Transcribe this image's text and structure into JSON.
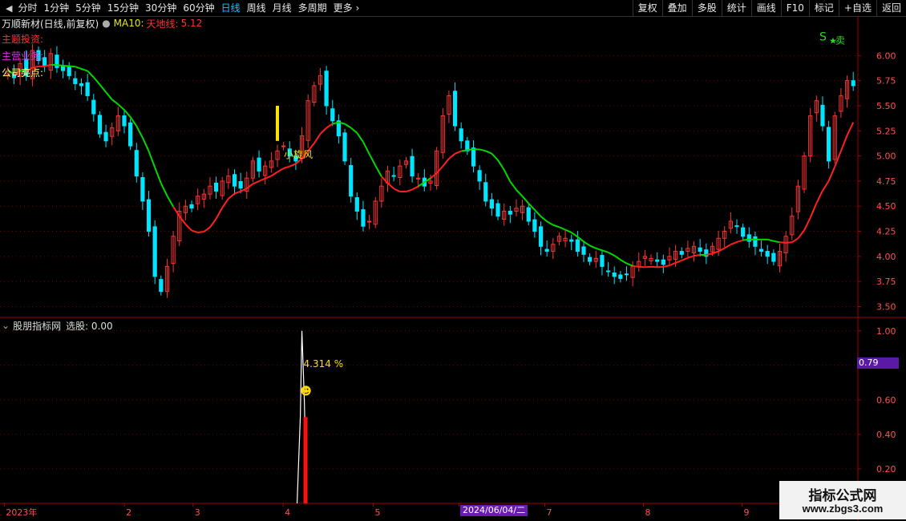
{
  "toolbar": {
    "periods": [
      "分时",
      "1分钟",
      "5分钟",
      "15分钟",
      "30分钟",
      "60分钟",
      "日线",
      "周线",
      "月线",
      "多周期",
      "更多"
    ],
    "active_period": "日线",
    "actions": [
      "复权",
      "叠加",
      "多股",
      "统计",
      "画线",
      "F10",
      "标记",
      "+自选",
      "返回"
    ]
  },
  "main_panel": {
    "stock_title": "万顺新材(日线,前复权)",
    "ma_label": "MA10:",
    "tiandi_label": "天地线:",
    "tiandi_value": "5.12",
    "info_lines": [
      "主题投资:",
      "主营业务:",
      "公司亮点:"
    ],
    "annotation_sell": "S",
    "annotation_sell_text": "卖",
    "annotation_xuanfeng": "小旋风",
    "y_ticks": [
      "6.00",
      "5.75",
      "5.50",
      "5.25",
      "5.00",
      "4.75",
      "4.50",
      "4.25",
      "4.00",
      "3.75",
      "3.50"
    ]
  },
  "sub_panel": {
    "title": "股朋指标网",
    "select_label": "选股: 0.00",
    "percent_label": "4.314 %",
    "y_ticks": [
      "1.00",
      "0.80",
      "0.60",
      "0.40",
      "0.20"
    ],
    "current_value": "0.79"
  },
  "x_axis": {
    "labels": [
      "2023年",
      "2",
      "3",
      "4",
      "5",
      "6",
      "7",
      "8",
      "9"
    ],
    "cursor_date": "2024/06/04/二"
  },
  "watermark": {
    "site_name": "指标公式网",
    "url": "www.zbgs3.com"
  },
  "colors": {
    "up": "#ff3232",
    "down": "#00e5ff",
    "ma_green": "#00d800",
    "ma_red": "#ff2020",
    "grid": "#7a0000"
  },
  "chart_data": {
    "type": "candlestick",
    "y_range": [
      3.4,
      6.25
    ],
    "sub_y_range": [
      0,
      1.05
    ],
    "closes": [
      5.85,
      5.78,
      5.92,
      5.8,
      6.05,
      5.95,
      5.9,
      6.02,
      5.88,
      5.85,
      5.8,
      5.72,
      5.7,
      5.6,
      5.42,
      5.22,
      5.15,
      5.28,
      5.4,
      5.3,
      5.1,
      4.8,
      4.55,
      4.25,
      3.8,
      3.65,
      3.9,
      4.2,
      4.45,
      4.5,
      4.48,
      4.6,
      4.62,
      4.7,
      4.65,
      4.75,
      4.8,
      4.7,
      4.68,
      4.78,
      4.95,
      4.85,
      4.9,
      4.95,
      5.05,
      5.1,
      5.0,
      4.95,
      5.2,
      5.55,
      5.7,
      5.8,
      5.5,
      5.35,
      5.2,
      4.95,
      4.6,
      4.45,
      4.3,
      4.35,
      4.55,
      4.7,
      4.85,
      4.8,
      4.9,
      4.95,
      4.8,
      4.78,
      4.7,
      4.75,
      5.05,
      5.4,
      5.6,
      5.3,
      5.15,
      5.05,
      4.9,
      4.75,
      4.55,
      4.48,
      4.4,
      4.45,
      4.42,
      4.48,
      4.5,
      4.35,
      4.25,
      4.1,
      4.05,
      4.12,
      4.2,
      4.18,
      4.15,
      4.05,
      4.02,
      3.95,
      3.98,
      3.9,
      3.85,
      3.8,
      3.78,
      3.82,
      3.9,
      3.95,
      4.0,
      3.98,
      3.95,
      3.92,
      4.0,
      4.05,
      4.02,
      4.08,
      4.1,
      4.05,
      4.0,
      4.1,
      4.18,
      4.25,
      4.35,
      4.3,
      4.2,
      4.15,
      4.1,
      4.05,
      4.0,
      3.95,
      4.05,
      4.2,
      4.4,
      4.7,
      5.0,
      5.4,
      5.55,
      5.3,
      4.95,
      5.4,
      5.6,
      5.75,
      5.7
    ],
    "sub_values": {
      "spike_value": 1.0,
      "bar_value": 0.5
    }
  }
}
